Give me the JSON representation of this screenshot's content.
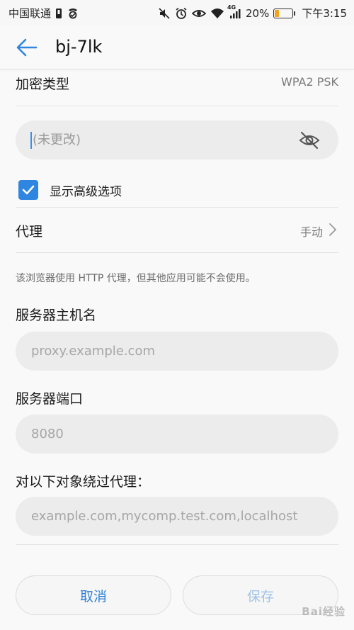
{
  "status_bar": {
    "carrier": "中国联通",
    "battery_percent_text": "20%",
    "battery_level": 0.2,
    "network_type": "4G",
    "time": "下午3:15"
  },
  "app_bar": {
    "title": "bj-7lk",
    "back_icon": "arrow-left-icon"
  },
  "encryption": {
    "label": "加密类型",
    "value": "WPA2 PSK"
  },
  "password": {
    "placeholder": "(未更改)",
    "value": "",
    "toggle_icon": "eye-off-icon"
  },
  "advanced": {
    "label": "显示高级选项",
    "checked": true
  },
  "proxy": {
    "label": "代理",
    "value": "手动"
  },
  "hint": "该浏览器使用 HTTP 代理，但其他应用可能不会使用。",
  "hostname": {
    "label": "服务器主机名",
    "placeholder": "proxy.example.com"
  },
  "port": {
    "label": "服务器端口",
    "placeholder": "8080"
  },
  "bypass": {
    "label": "对以下对象绕过代理：",
    "placeholder": "example.com,mycomp.test.com,localhost"
  },
  "buttons": {
    "cancel": "取消",
    "save": "保存"
  },
  "colors": {
    "accent": "#2f86e0",
    "battery": "#f3a21a"
  },
  "watermark": "Bai经验"
}
